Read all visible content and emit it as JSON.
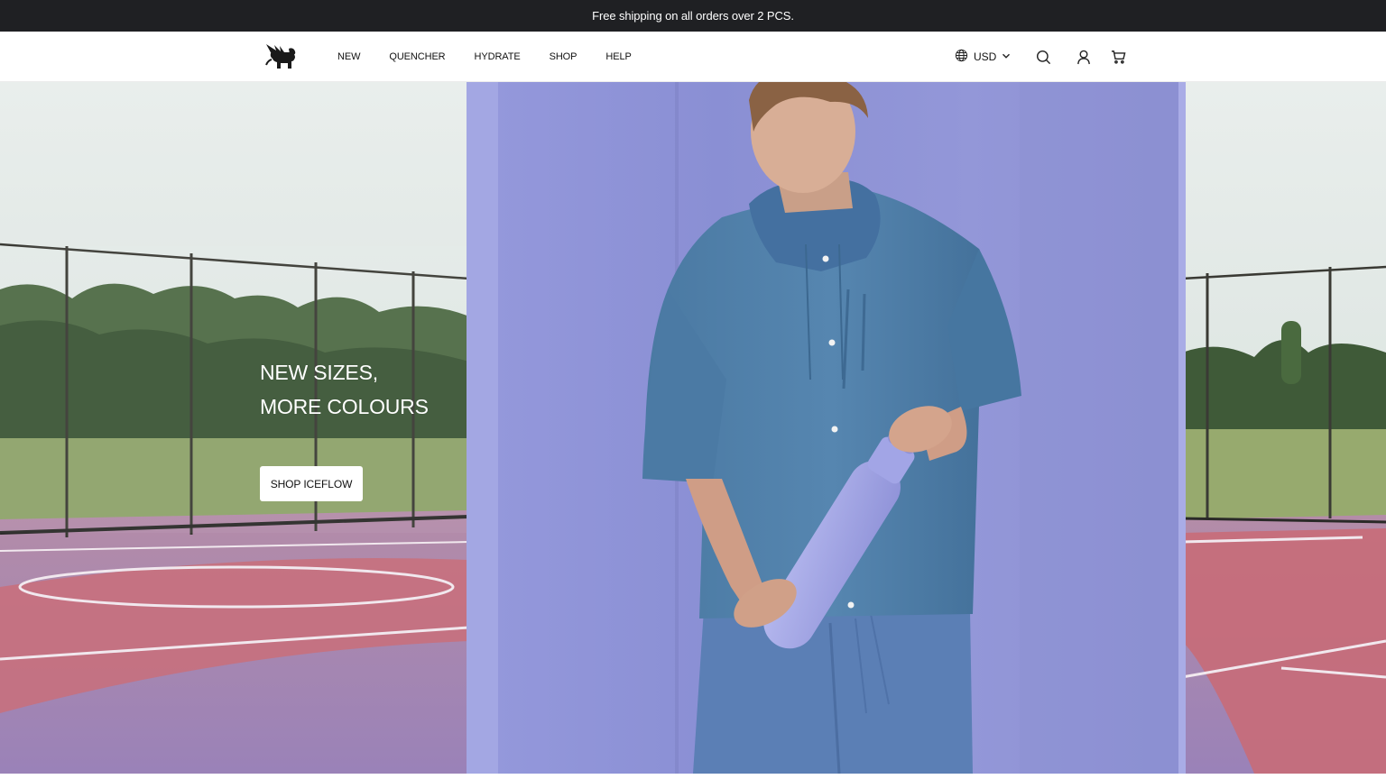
{
  "announcement": {
    "text": "Free shipping on all orders over 2 PCS."
  },
  "header": {
    "logo_icon": "winged-lion-logo-icon",
    "nav": [
      {
        "label": "NEW"
      },
      {
        "label": "QUENCHER"
      },
      {
        "label": "HYDRATE"
      },
      {
        "label": "SHOP"
      },
      {
        "label": "HELP"
      }
    ],
    "currency": {
      "label": "USD",
      "icon": "globe-icon",
      "chevron": "chevron-down-icon"
    },
    "tools": {
      "search_icon": "search-icon",
      "account_icon": "user-icon",
      "cart_icon": "cart-icon"
    }
  },
  "hero": {
    "title_line1": "NEW SIZES,",
    "title_line2": "MORE COLOURS",
    "cta_label": "SHOP ICEFLOW",
    "image": "model-holding-lavender-bottle-on-sports-court",
    "colors": {
      "wall": "#8f93d6",
      "shirt": "#4f7fa8",
      "bottle": "#a6a9e6",
      "court_red": "#c86c78",
      "court_purple": "#9b86b8"
    }
  }
}
